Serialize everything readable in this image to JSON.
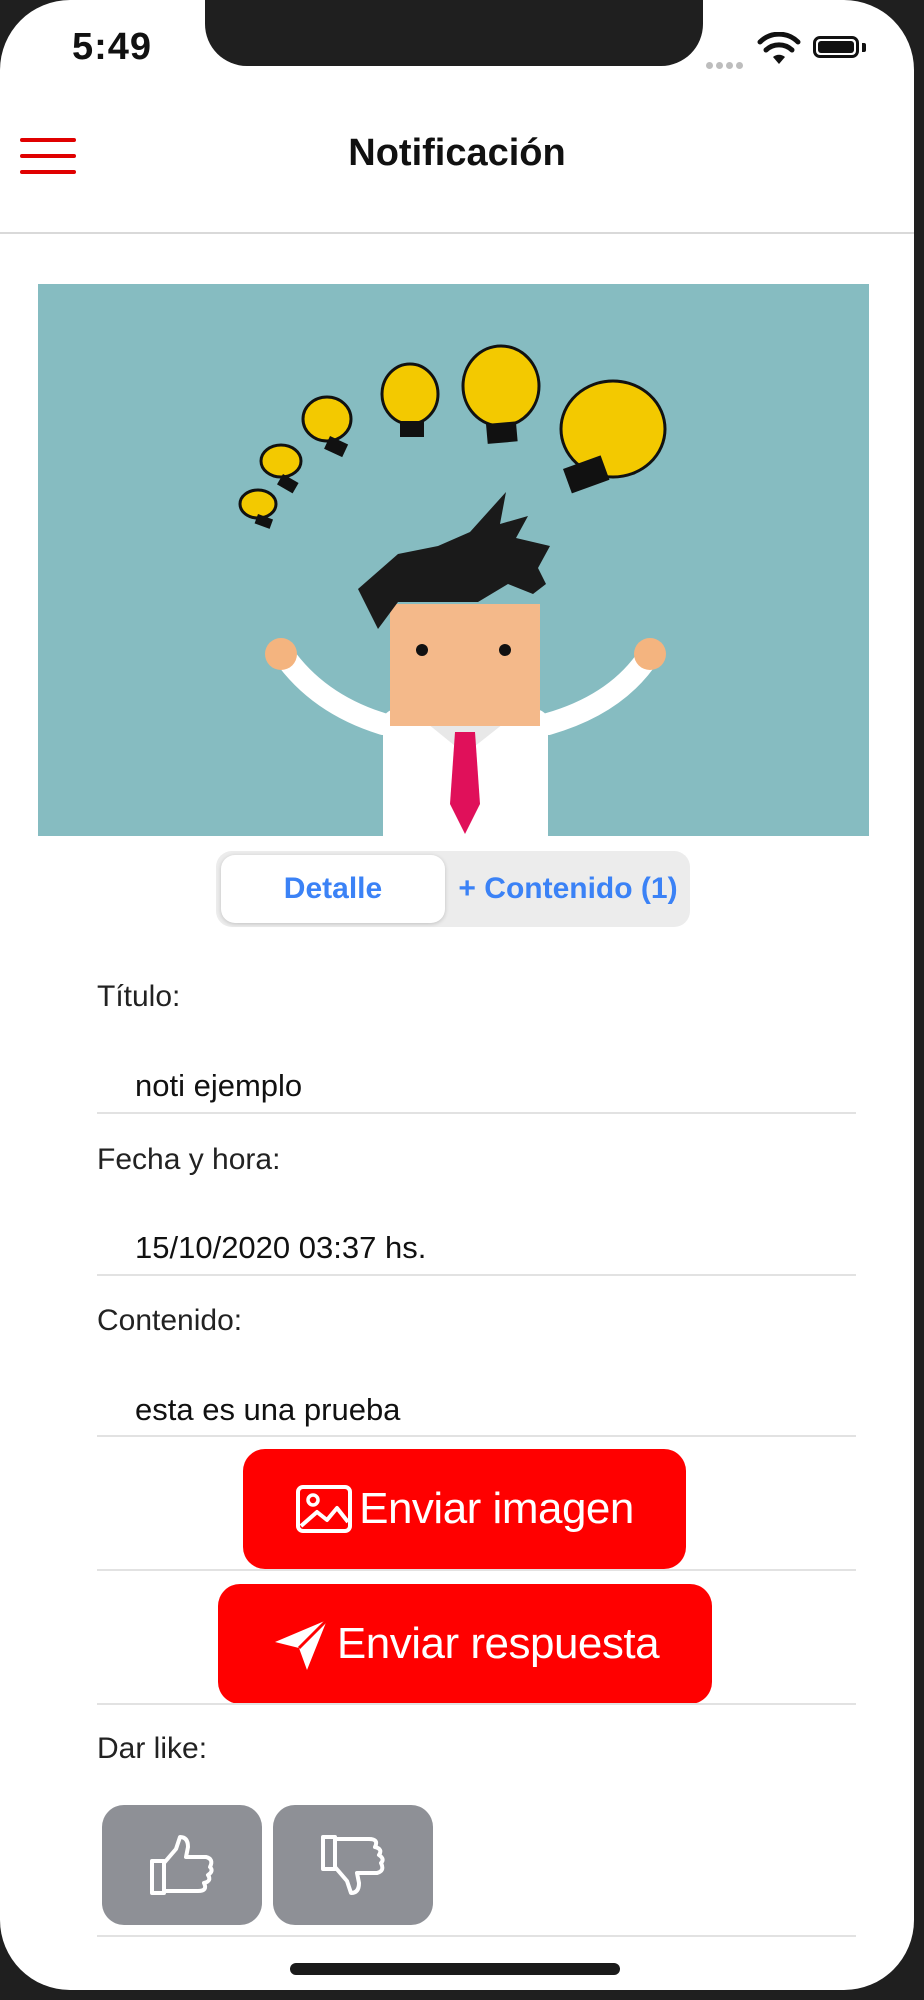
{
  "status_bar": {
    "time": "5:49",
    "icons": [
      "cellular-dots-icon",
      "wifi-icon",
      "battery-icon"
    ]
  },
  "navbar": {
    "title": "Notificación",
    "menu_icon": "hamburger-menu-icon",
    "accent_color": "#e00000"
  },
  "hero": {
    "icon": "ideas-lightbulbs-illustration",
    "background": "#86bcc1"
  },
  "segmented": {
    "selected": "Detalle",
    "options": [
      "Detalle",
      "+ Contenido (1)"
    ]
  },
  "fields": [
    {
      "label": "Título:",
      "value": "noti ejemplo"
    },
    {
      "label": "Fecha y hora:",
      "value": "15/10/2020 03:37 hs."
    },
    {
      "label": "Contenido:",
      "value": "esta es una prueba"
    }
  ],
  "actions": {
    "send_image": {
      "label": "Enviar imagen",
      "icon": "image-icon"
    },
    "send_reply": {
      "label": "Enviar respuesta",
      "icon": "paper-plane-icon"
    },
    "button_color": "#ff0000"
  },
  "like": {
    "label": "Dar like:",
    "buttons": [
      {
        "icon": "thumbs-up-icon"
      },
      {
        "icon": "thumbs-down-icon"
      }
    ]
  }
}
